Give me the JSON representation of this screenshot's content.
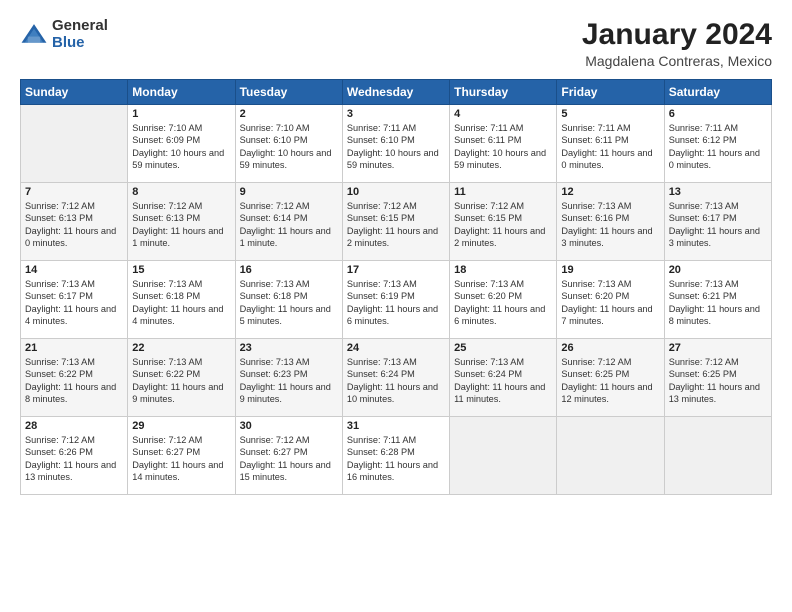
{
  "logo": {
    "general": "General",
    "blue": "Blue"
  },
  "title": "January 2024",
  "subtitle": "Magdalena Contreras, Mexico",
  "days_header": [
    "Sunday",
    "Monday",
    "Tuesday",
    "Wednesday",
    "Thursday",
    "Friday",
    "Saturday"
  ],
  "weeks": [
    [
      {
        "num": "",
        "empty": true
      },
      {
        "num": "1",
        "sunrise": "7:10 AM",
        "sunset": "6:09 PM",
        "daylight": "10 hours and 59 minutes."
      },
      {
        "num": "2",
        "sunrise": "7:10 AM",
        "sunset": "6:10 PM",
        "daylight": "10 hours and 59 minutes."
      },
      {
        "num": "3",
        "sunrise": "7:11 AM",
        "sunset": "6:10 PM",
        "daylight": "10 hours and 59 minutes."
      },
      {
        "num": "4",
        "sunrise": "7:11 AM",
        "sunset": "6:11 PM",
        "daylight": "10 hours and 59 minutes."
      },
      {
        "num": "5",
        "sunrise": "7:11 AM",
        "sunset": "6:11 PM",
        "daylight": "11 hours and 0 minutes."
      },
      {
        "num": "6",
        "sunrise": "7:11 AM",
        "sunset": "6:12 PM",
        "daylight": "11 hours and 0 minutes."
      }
    ],
    [
      {
        "num": "7",
        "sunrise": "7:12 AM",
        "sunset": "6:13 PM",
        "daylight": "11 hours and 0 minutes."
      },
      {
        "num": "8",
        "sunrise": "7:12 AM",
        "sunset": "6:13 PM",
        "daylight": "11 hours and 1 minute."
      },
      {
        "num": "9",
        "sunrise": "7:12 AM",
        "sunset": "6:14 PM",
        "daylight": "11 hours and 1 minute."
      },
      {
        "num": "10",
        "sunrise": "7:12 AM",
        "sunset": "6:15 PM",
        "daylight": "11 hours and 2 minutes."
      },
      {
        "num": "11",
        "sunrise": "7:12 AM",
        "sunset": "6:15 PM",
        "daylight": "11 hours and 2 minutes."
      },
      {
        "num": "12",
        "sunrise": "7:13 AM",
        "sunset": "6:16 PM",
        "daylight": "11 hours and 3 minutes."
      },
      {
        "num": "13",
        "sunrise": "7:13 AM",
        "sunset": "6:17 PM",
        "daylight": "11 hours and 3 minutes."
      }
    ],
    [
      {
        "num": "14",
        "sunrise": "7:13 AM",
        "sunset": "6:17 PM",
        "daylight": "11 hours and 4 minutes."
      },
      {
        "num": "15",
        "sunrise": "7:13 AM",
        "sunset": "6:18 PM",
        "daylight": "11 hours and 4 minutes."
      },
      {
        "num": "16",
        "sunrise": "7:13 AM",
        "sunset": "6:18 PM",
        "daylight": "11 hours and 5 minutes."
      },
      {
        "num": "17",
        "sunrise": "7:13 AM",
        "sunset": "6:19 PM",
        "daylight": "11 hours and 6 minutes."
      },
      {
        "num": "18",
        "sunrise": "7:13 AM",
        "sunset": "6:20 PM",
        "daylight": "11 hours and 6 minutes."
      },
      {
        "num": "19",
        "sunrise": "7:13 AM",
        "sunset": "6:20 PM",
        "daylight": "11 hours and 7 minutes."
      },
      {
        "num": "20",
        "sunrise": "7:13 AM",
        "sunset": "6:21 PM",
        "daylight": "11 hours and 8 minutes."
      }
    ],
    [
      {
        "num": "21",
        "sunrise": "7:13 AM",
        "sunset": "6:22 PM",
        "daylight": "11 hours and 8 minutes."
      },
      {
        "num": "22",
        "sunrise": "7:13 AM",
        "sunset": "6:22 PM",
        "daylight": "11 hours and 9 minutes."
      },
      {
        "num": "23",
        "sunrise": "7:13 AM",
        "sunset": "6:23 PM",
        "daylight": "11 hours and 9 minutes."
      },
      {
        "num": "24",
        "sunrise": "7:13 AM",
        "sunset": "6:24 PM",
        "daylight": "11 hours and 10 minutes."
      },
      {
        "num": "25",
        "sunrise": "7:13 AM",
        "sunset": "6:24 PM",
        "daylight": "11 hours and 11 minutes."
      },
      {
        "num": "26",
        "sunrise": "7:12 AM",
        "sunset": "6:25 PM",
        "daylight": "11 hours and 12 minutes."
      },
      {
        "num": "27",
        "sunrise": "7:12 AM",
        "sunset": "6:25 PM",
        "daylight": "11 hours and 13 minutes."
      }
    ],
    [
      {
        "num": "28",
        "sunrise": "7:12 AM",
        "sunset": "6:26 PM",
        "daylight": "11 hours and 13 minutes."
      },
      {
        "num": "29",
        "sunrise": "7:12 AM",
        "sunset": "6:27 PM",
        "daylight": "11 hours and 14 minutes."
      },
      {
        "num": "30",
        "sunrise": "7:12 AM",
        "sunset": "6:27 PM",
        "daylight": "11 hours and 15 minutes."
      },
      {
        "num": "31",
        "sunrise": "7:11 AM",
        "sunset": "6:28 PM",
        "daylight": "11 hours and 16 minutes."
      },
      {
        "num": "",
        "empty": true
      },
      {
        "num": "",
        "empty": true
      },
      {
        "num": "",
        "empty": true
      }
    ]
  ]
}
